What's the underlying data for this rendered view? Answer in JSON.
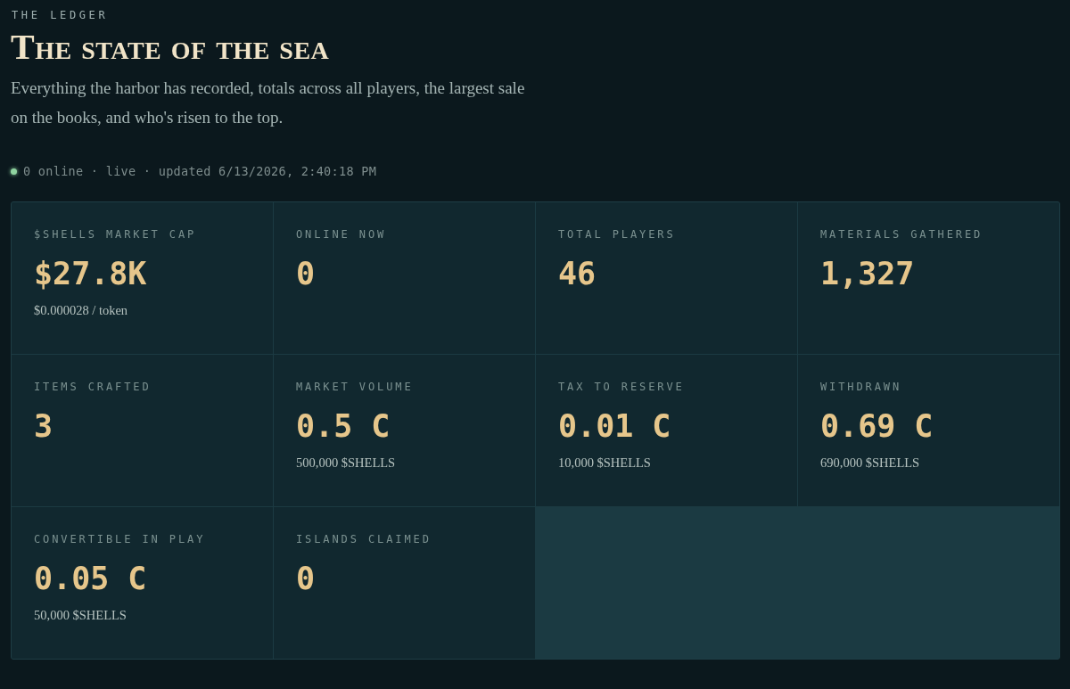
{
  "header": {
    "eyebrow": "THE LEDGER",
    "title": "The state of the sea",
    "intro": "Everything the harbor has recorded, totals across all players, the largest sale on the books, and who's risen to the top.",
    "status": "0 online · live · updated 6/13/2026, 2:40:18 PM"
  },
  "stats": [
    {
      "label": "$SHELLS MARKET CAP",
      "value": "$27.8K",
      "note": "$0.000028 / token"
    },
    {
      "label": "ONLINE NOW",
      "value": "0"
    },
    {
      "label": "TOTAL PLAYERS",
      "value": "46"
    },
    {
      "label": "MATERIALS GATHERED",
      "value": "1,327"
    },
    {
      "label": "ITEMS CRAFTED",
      "value": "3"
    },
    {
      "label": "MARKET VOLUME",
      "value": "0.5 C",
      "note": "500,000 $SHELLS"
    },
    {
      "label": "TAX TO RESERVE",
      "value": "0.01 C",
      "note": "10,000 $SHELLS"
    },
    {
      "label": "WITHDRAWN",
      "value": "0.69 C",
      "note": "690,000 $SHELLS"
    },
    {
      "label": "CONVERTIBLE IN PLAY",
      "value": "0.05 C",
      "note": "50,000 $SHELLS"
    },
    {
      "label": "ISLANDS CLAIMED",
      "value": "0"
    }
  ]
}
